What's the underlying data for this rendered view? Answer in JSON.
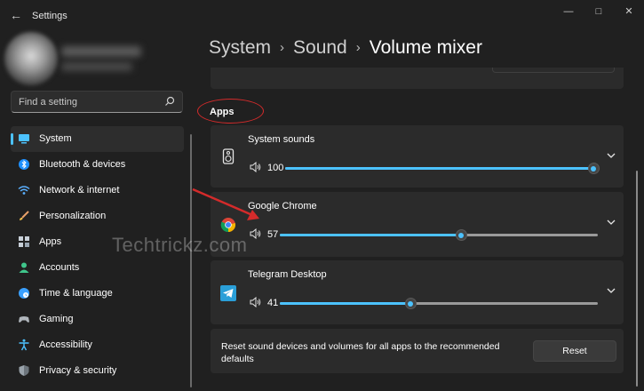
{
  "window": {
    "title": "Settings",
    "controls": [
      "minimize-icon",
      "maximize-icon",
      "close-icon"
    ]
  },
  "search": {
    "placeholder": "Find a setting"
  },
  "nav": {
    "items": [
      {
        "label": "System",
        "icon": "system-icon",
        "active": true
      },
      {
        "label": "Bluetooth & devices",
        "icon": "bluetooth-icon"
      },
      {
        "label": "Network & internet",
        "icon": "wifi-icon"
      },
      {
        "label": "Personalization",
        "icon": "brush-icon"
      },
      {
        "label": "Apps",
        "icon": "apps-icon"
      },
      {
        "label": "Accounts",
        "icon": "accounts-icon"
      },
      {
        "label": "Time & language",
        "icon": "globe-icon"
      },
      {
        "label": "Gaming",
        "icon": "gaming-icon"
      },
      {
        "label": "Accessibility",
        "icon": "accessibility-icon"
      },
      {
        "label": "Privacy & security",
        "icon": "shield-icon"
      }
    ]
  },
  "breadcrumb": {
    "crumb1": "System",
    "crumb2": "Sound",
    "current": "Volume mixer",
    "separator": "›"
  },
  "apps_section": {
    "heading": "Apps"
  },
  "apps": [
    {
      "name": "System sounds",
      "volume": "100",
      "level": 1.0,
      "icon": "speaker-icon"
    },
    {
      "name": "Google Chrome",
      "volume": "57",
      "level": 0.57,
      "icon": "chrome-icon"
    },
    {
      "name": "Telegram Desktop",
      "volume": "41",
      "level": 0.41,
      "icon": "telegram-icon"
    }
  ],
  "reset": {
    "description": "Reset sound devices and volumes for all apps to the recommended defaults",
    "button_label": "Reset"
  },
  "watermark": "Techtrickz.com",
  "colors": {
    "accent": "#4cc2ff",
    "background": "#202020",
    "card": "#2b2b2b",
    "annotation": "#d42b2b"
  }
}
